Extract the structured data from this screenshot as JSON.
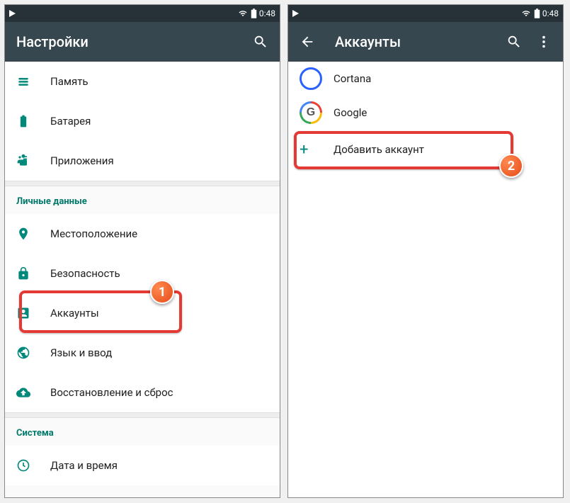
{
  "status": {
    "time": "0:48"
  },
  "left": {
    "title": "Настройки",
    "items": {
      "memory": "Память",
      "battery": "Батарея",
      "apps": "Приложения"
    },
    "personal": {
      "header": "Личные данные",
      "location": "Местоположение",
      "security": "Безопасность",
      "accounts": "Аккаунты",
      "language": "Язык и ввод",
      "backup": "Восстановление и сброс"
    },
    "system": {
      "header": "Система",
      "datetime": "Дата и время"
    }
  },
  "right": {
    "title": "Аккаунты",
    "cortana": "Cortana",
    "google": "Google",
    "add": "Добавить аккаунт"
  },
  "badges": {
    "b1": "1",
    "b2": "2"
  }
}
